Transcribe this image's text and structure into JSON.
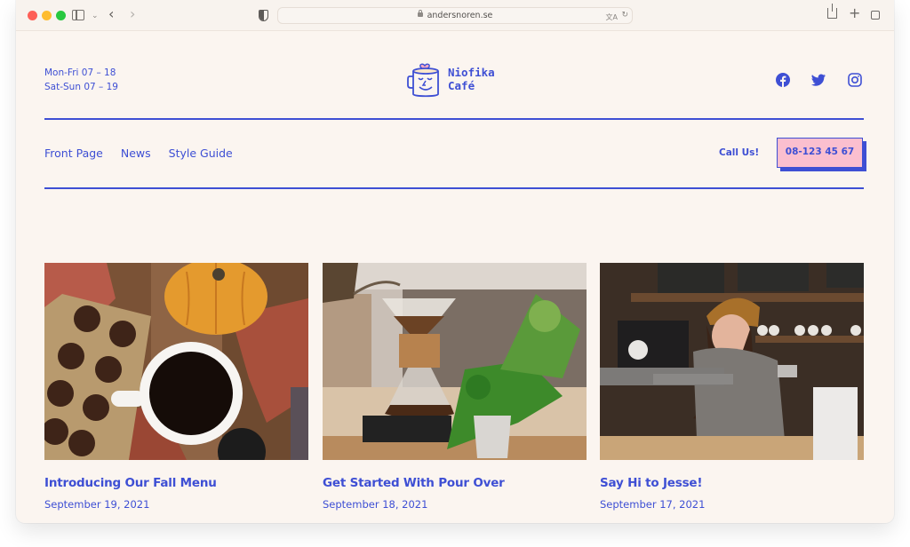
{
  "browser": {
    "url": "andersnoren.se",
    "icons": [
      "sidebar-icon",
      "chevron-down-icon",
      "back-icon",
      "forward-icon",
      "privacy-shield-icon",
      "lock-icon",
      "translate-icon",
      "reload-icon",
      "share-icon",
      "new-tab-icon",
      "tab-overview-icon"
    ],
    "back_glyph": "‹",
    "forward_glyph": "›",
    "chevron_glyph": "⌄",
    "translate_glyph": "文A",
    "reload_glyph": "↻",
    "plus_glyph": "+"
  },
  "header": {
    "hours": [
      "Mon-Fri 07 – 18",
      "Sat-Sun 07 – 19"
    ],
    "logo": {
      "line1": "Niofika",
      "line2": "Café"
    },
    "social": [
      {
        "name": "Facebook",
        "icon": "facebook-icon"
      },
      {
        "name": "Twitter",
        "icon": "twitter-icon"
      },
      {
        "name": "Instagram",
        "icon": "instagram-icon"
      }
    ]
  },
  "nav": {
    "items": [
      {
        "label": "Front Page"
      },
      {
        "label": "News"
      },
      {
        "label": "Style Guide"
      }
    ],
    "call_label": "Call Us!",
    "phone": "08-123 45 67"
  },
  "posts": [
    {
      "title": "Introducing Our Fall Menu",
      "date": "September 19, 2021",
      "image": "coffee cup with pumpkin, chocolates and autumn leaves"
    },
    {
      "title": "Get Started With Pour Over",
      "date": "September 18, 2021",
      "image": "pour over coffee maker next to potted plants"
    },
    {
      "title": "Say Hi to Jesse!",
      "date": "September 17, 2021",
      "image": "smiling barista in a beanie behind the counter"
    }
  ],
  "colors": {
    "accent": "#3e4fd4",
    "background": "#fbf5f0",
    "button_fill": "#fbbfcf",
    "heart": "#f6a9c3"
  }
}
